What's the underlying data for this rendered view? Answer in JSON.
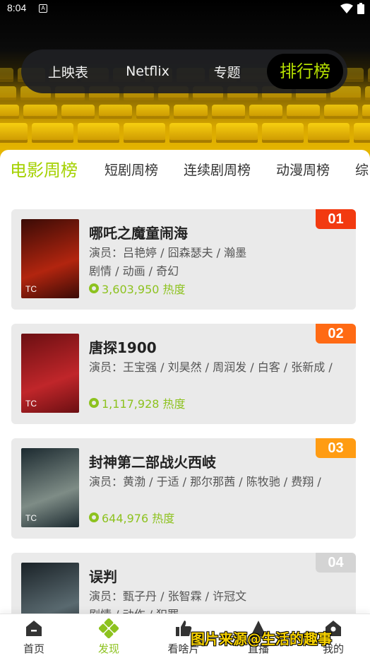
{
  "status": {
    "time": "8:04",
    "notif": "A"
  },
  "topnav": {
    "items": [
      "上映表",
      "Netflix",
      "专题",
      "排行榜"
    ],
    "active": 3
  },
  "tabs": [
    "电影周榜",
    "短剧周榜",
    "连续剧周榜",
    "动漫周榜",
    "综"
  ],
  "movies": [
    {
      "rank": "01",
      "rank_color": "#f23a10",
      "title": "哪吒之魔童闹海",
      "actors": "演员：吕艳婷 / 囧森瑟夫 / 瀚墨",
      "genre": "剧情 / 动画 / 奇幻",
      "heat": "3,603,950 热度",
      "badge": "TC",
      "poster_colors": [
        "#3a0b06",
        "#b2250f"
      ]
    },
    {
      "rank": "02",
      "rank_color": "#ff6a14",
      "title": "唐探1900",
      "actors": "演员：王宝强 / 刘昊然 / 周润发 / 白客 / 张新成 /",
      "genre": "",
      "heat": "1,117,928 热度",
      "badge": "TC",
      "poster_colors": [
        "#6b0f12",
        "#c0262a"
      ]
    },
    {
      "rank": "03",
      "rank_color": "#ff9c13",
      "title": "封神第二部战火西岐",
      "actors": "演员：黄渤 / 于适 / 那尔那茜 / 陈牧驰 / 费翔 /",
      "genre": "",
      "heat": "644,976 热度",
      "badge": "TC",
      "poster_colors": [
        "#1c2a30",
        "#7e8c86"
      ]
    },
    {
      "rank": "04",
      "rank_color": "#d4d4d4",
      "title": "误判",
      "actors": "演员：甄子丹 / 张智霖 / 许冠文",
      "genre": "剧情 / 动作 / 犯罪",
      "heat": "",
      "badge": "",
      "poster_colors": [
        "#1a2227",
        "#5a6a70"
      ]
    }
  ],
  "bottomnav": {
    "items": [
      {
        "label": "首页",
        "icon": "home-icon"
      },
      {
        "label": "发现",
        "icon": "discover-icon"
      },
      {
        "label": "看啥片",
        "icon": "thumbs-up-icon"
      },
      {
        "label": "直播",
        "icon": "live-icon"
      },
      {
        "label": "我的",
        "icon": "profile-icon"
      }
    ],
    "active": 1
  },
  "watermark": "图片来源@生活的趣事",
  "colors": {
    "accent": "#a4d100",
    "heat": "#8dc21f"
  }
}
